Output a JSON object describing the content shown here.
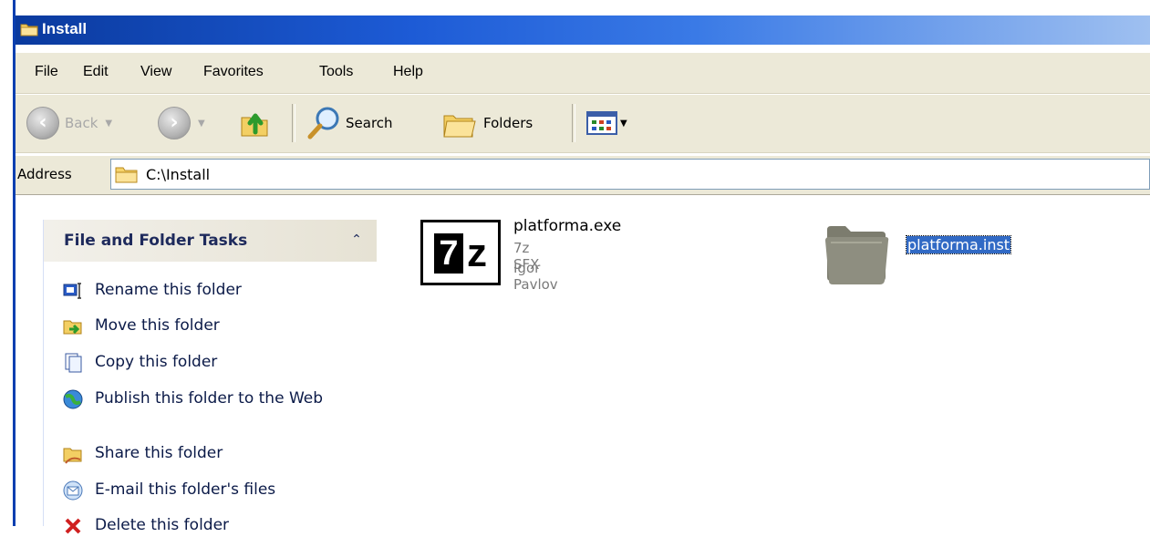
{
  "window": {
    "title": "Install"
  },
  "menu": {
    "file": "File",
    "edit": "Edit",
    "view": "View",
    "favorites": "Favorites",
    "tools": "Tools",
    "help": "Help"
  },
  "toolbar": {
    "back": "Back",
    "search": "Search",
    "folders": "Folders"
  },
  "address": {
    "label": "Address",
    "value": "C:\\Install"
  },
  "tasks": {
    "title": "File and Folder Tasks",
    "items": [
      {
        "label": "Rename this folder",
        "icon": "rename-icon"
      },
      {
        "label": "Move this folder",
        "icon": "move-icon"
      },
      {
        "label": "Copy this folder",
        "icon": "copy-icon"
      },
      {
        "label": "Publish this folder to the Web",
        "icon": "publish-web-icon"
      },
      {
        "label": "Share this folder",
        "icon": "share-icon"
      },
      {
        "label": "E-mail this folder's files",
        "icon": "email-icon"
      },
      {
        "label": "Delete this folder",
        "icon": "delete-icon"
      }
    ]
  },
  "files": [
    {
      "name": "platforma.exe",
      "type": "7z SFX",
      "company": "Igor Pavlov",
      "icon": "7z-sfx-icon"
    },
    {
      "name": "platforma.inst",
      "icon": "folder-icon",
      "selected": true
    }
  ],
  "colors": {
    "titlebar_start": "#0a3a9e",
    "chrome": "#ece9d8",
    "selection": "#316ac5",
    "task_text": "#0b1a48"
  }
}
